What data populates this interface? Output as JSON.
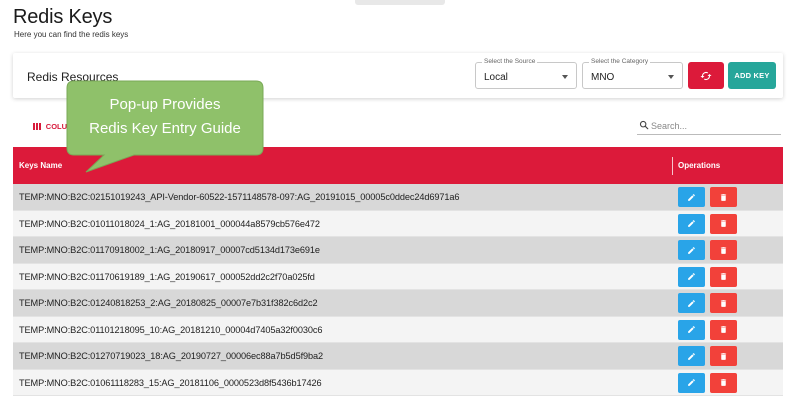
{
  "page": {
    "title": "Redis Keys",
    "subtitle": "Here you can find the redis keys"
  },
  "resources": {
    "title": "Redis Resources",
    "source": {
      "legend": "Select the Source",
      "value": "Local"
    },
    "category": {
      "legend": "Select the Category",
      "value": "MNO"
    },
    "add_key_label": "ADD KEY"
  },
  "toolbar": {
    "columns_label": "COLU",
    "search_placeholder": "Search..."
  },
  "table": {
    "headers": {
      "keys": "Keys Name",
      "operations": "Operations"
    },
    "rows": [
      {
        "key": "TEMP:MNO:B2C:02151019243_API-Vendor-60522-1571148578-097:AG_20191015_00005c0ddec24d6971a6"
      },
      {
        "key": "TEMP:MNO:B2C:01011018024_1:AG_20181001_000044a8579cb576e472"
      },
      {
        "key": "TEMP:MNO:B2C:01170918002_1:AG_20180917_00007cd5134d173e691e"
      },
      {
        "key": "TEMP:MNO:B2C:01170619189_1:AG_20190617_000052dd2c2f70a025fd"
      },
      {
        "key": "TEMP:MNO:B2C:01240818253_2:AG_20180825_00007e7b31f382c6d2c2"
      },
      {
        "key": "TEMP:MNO:B2C:01101218095_10:AG_20181210_00004d7405a32f0030c6"
      },
      {
        "key": "TEMP:MNO:B2C:01270719023_18:AG_20190727_00006ec88a7b5d5f9ba2"
      },
      {
        "key": "TEMP:MNO:B2C:01061118283_15:AG_20181106_0000523d8f5436b17426"
      }
    ]
  },
  "callout": {
    "line1": "Pop-up Provides",
    "line2": "Redis Key Entry Guide"
  },
  "colors": {
    "header_red": "#dc1a3a",
    "add_key_teal": "#26a69a",
    "edit_blue": "#29a4e8",
    "delete_red": "#f2413a",
    "callout_green": "#8fc16a"
  },
  "icons": {
    "refresh": "refresh-icon",
    "columns": "columns-icon",
    "search": "search-icon",
    "edit": "pencil-icon",
    "delete": "trash-icon"
  }
}
